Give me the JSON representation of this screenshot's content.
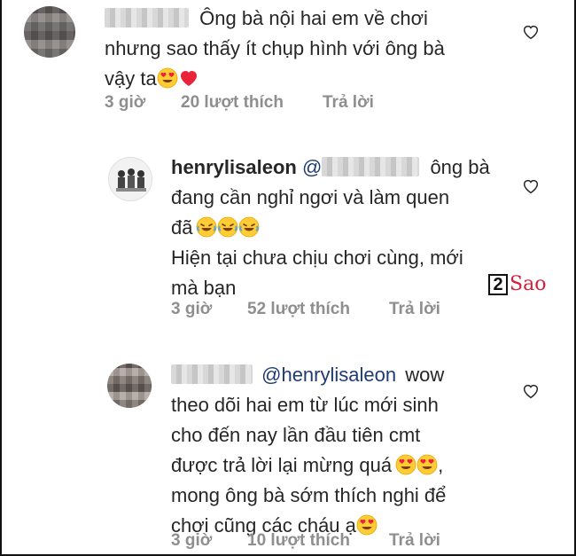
{
  "comments": [
    {
      "lines": [
        "Ông bà nội hai em về chơi",
        "nhưng sao thấy ít chụp hình với ông bà",
        "vậy ta"
      ],
      "emojis": [
        "heart-eyes",
        "red-heart"
      ],
      "time": "3 giờ",
      "likes": "20 lượt thích",
      "reply": "Trả lời"
    },
    {
      "username": "henrylisaleon",
      "mention_prefix": "@",
      "line1_suffix": "ông bà",
      "lines": [
        "đang cần nghỉ ngơi và làm quen",
        "đã",
        "Hiện tại chưa chịu chơi cùng, mới",
        "mà bạn"
      ],
      "emojis": [
        "rofl",
        "rofl",
        "rofl"
      ],
      "time": "3 giờ",
      "likes": "52 lượt thích",
      "reply": "Trả lời"
    },
    {
      "mention": "@henrylisaleon",
      "line1_suffix": "wow",
      "lines": [
        "theo dõi hai em từ lúc mới sinh",
        "cho đến nay lần đầu tiên cmt",
        "được trả lời lại mừng quá",
        "mong ông bà sớm thích nghi để",
        "chơi cũng các cháu ạ"
      ],
      "emojis": [
        "heart-eyes",
        "heart-eyes",
        "heart-eyes"
      ],
      "time": "3 giờ",
      "likes": "10 lượt thích",
      "reply": "Trả lời"
    }
  ],
  "watermark": {
    "box": "2",
    "text": "Sao"
  }
}
